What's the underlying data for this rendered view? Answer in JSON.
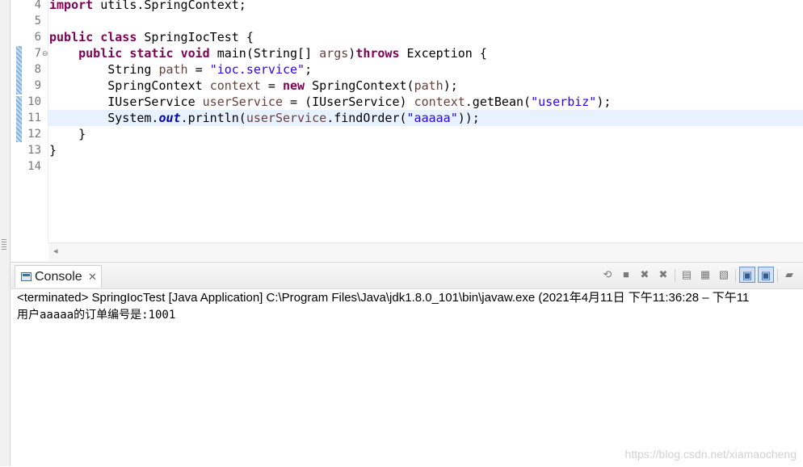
{
  "editor": {
    "line_numbers": [
      "4",
      "5",
      "6",
      "7",
      "8",
      "9",
      "10",
      "11",
      "12",
      "13",
      "14"
    ],
    "fold_marker_line": "7",
    "current_line": "11",
    "code_lines": [
      [
        {
          "t": "import",
          "c": "kw"
        },
        {
          "t": " utils.SpringContext;",
          "c": ""
        }
      ],
      [],
      [
        {
          "t": "public",
          "c": "kw"
        },
        {
          "t": " ",
          "c": ""
        },
        {
          "t": "class",
          "c": "kw"
        },
        {
          "t": " SpringIocTest {",
          "c": ""
        }
      ],
      [
        {
          "t": "    ",
          "c": ""
        },
        {
          "t": "public",
          "c": "kw"
        },
        {
          "t": " ",
          "c": ""
        },
        {
          "t": "static",
          "c": "kw"
        },
        {
          "t": " ",
          "c": ""
        },
        {
          "t": "void",
          "c": "kw"
        },
        {
          "t": " main(String[] ",
          "c": ""
        },
        {
          "t": "args",
          "c": "var"
        },
        {
          "t": ")",
          "c": ""
        },
        {
          "t": "throws",
          "c": "kw"
        },
        {
          "t": " Exception {",
          "c": ""
        }
      ],
      [
        {
          "t": "        String ",
          "c": ""
        },
        {
          "t": "path",
          "c": "var"
        },
        {
          "t": " = ",
          "c": ""
        },
        {
          "t": "\"ioc.service\"",
          "c": "str"
        },
        {
          "t": ";",
          "c": ""
        }
      ],
      [
        {
          "t": "        SpringContext ",
          "c": ""
        },
        {
          "t": "context",
          "c": "var"
        },
        {
          "t": " = ",
          "c": ""
        },
        {
          "t": "new",
          "c": "kw"
        },
        {
          "t": " SpringContext(",
          "c": ""
        },
        {
          "t": "path",
          "c": "var"
        },
        {
          "t": ");",
          "c": ""
        }
      ],
      [
        {
          "t": "        IUserService ",
          "c": ""
        },
        {
          "t": "userService",
          "c": "var"
        },
        {
          "t": " = (IUserService) ",
          "c": ""
        },
        {
          "t": "context",
          "c": "var"
        },
        {
          "t": ".getBean(",
          "c": ""
        },
        {
          "t": "\"userbiz\"",
          "c": "str"
        },
        {
          "t": ");",
          "c": ""
        }
      ],
      [
        {
          "t": "        System.",
          "c": ""
        },
        {
          "t": "out",
          "c": "fld"
        },
        {
          "t": ".println(",
          "c": ""
        },
        {
          "t": "userService",
          "c": "var"
        },
        {
          "t": ".findOrder(",
          "c": ""
        },
        {
          "t": "\"aaaaa\"",
          "c": "str"
        },
        {
          "t": "));",
          "c": ""
        }
      ],
      [
        {
          "t": "    }",
          "c": ""
        }
      ],
      [
        {
          "t": "}",
          "c": ""
        }
      ],
      []
    ]
  },
  "console": {
    "tab_label": "Console",
    "close_glyph": "✕",
    "status": "<terminated> SpringIocTest [Java Application] C:\\Program Files\\Java\\jdk1.8.0_101\\bin\\javaw.exe  (2021年4月11日 下午11:36:28 – 下午11",
    "output": "用户aaaaa的订单编号是:1001",
    "toolbar": [
      {
        "name": "pin-console-icon",
        "glyph": "⟲",
        "pressed": false
      },
      {
        "name": "terminate-icon",
        "glyph": "■",
        "pressed": false
      },
      {
        "name": "remove-launch-icon",
        "glyph": "✖",
        "pressed": false
      },
      {
        "name": "remove-all-terminated-icon",
        "glyph": "✖",
        "pressed": false
      },
      {
        "name": "clear-console-icon",
        "glyph": "▤",
        "pressed": false
      },
      {
        "name": "scroll-lock-icon",
        "glyph": "▦",
        "pressed": false
      },
      {
        "name": "word-wrap-icon",
        "glyph": "▧",
        "pressed": false
      },
      {
        "name": "show-on-stdout-icon",
        "glyph": "▣",
        "pressed": true
      },
      {
        "name": "show-on-stderr-icon",
        "glyph": "▣",
        "pressed": true
      },
      {
        "name": "open-console-icon",
        "glyph": "▰",
        "pressed": false
      }
    ]
  },
  "scroll_left_glyph": "◂",
  "watermark": "https://blog.csdn.net/xiamaocheng",
  "colors": {
    "keyword": "#7f0055",
    "string": "#2a00ff",
    "variable": "#6a3e3e",
    "field": "#0000c0",
    "current_line": "#e8f2fe"
  }
}
